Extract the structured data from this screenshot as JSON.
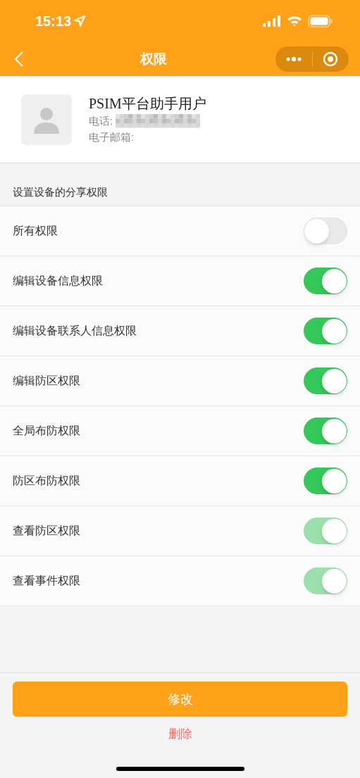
{
  "status_bar": {
    "time": "15:13"
  },
  "nav": {
    "title": "权限"
  },
  "profile": {
    "name": "PSIM平台助手用户",
    "phone_label": "电话:",
    "email_label": "电子邮箱:"
  },
  "section_title": "设置设备的分享权限",
  "permissions": [
    {
      "label": "所有权限",
      "on": false,
      "disabled": false
    },
    {
      "label": "编辑设备信息权限",
      "on": true,
      "disabled": false
    },
    {
      "label": "编辑设备联系人信息权限",
      "on": true,
      "disabled": false
    },
    {
      "label": "编辑防区权限",
      "on": true,
      "disabled": false
    },
    {
      "label": "全局布防权限",
      "on": true,
      "disabled": false
    },
    {
      "label": "防区布防权限",
      "on": true,
      "disabled": false
    },
    {
      "label": "查看防区权限",
      "on": true,
      "disabled": true
    },
    {
      "label": "查看事件权限",
      "on": true,
      "disabled": true
    }
  ],
  "buttons": {
    "primary": "修改",
    "danger": "删除"
  }
}
